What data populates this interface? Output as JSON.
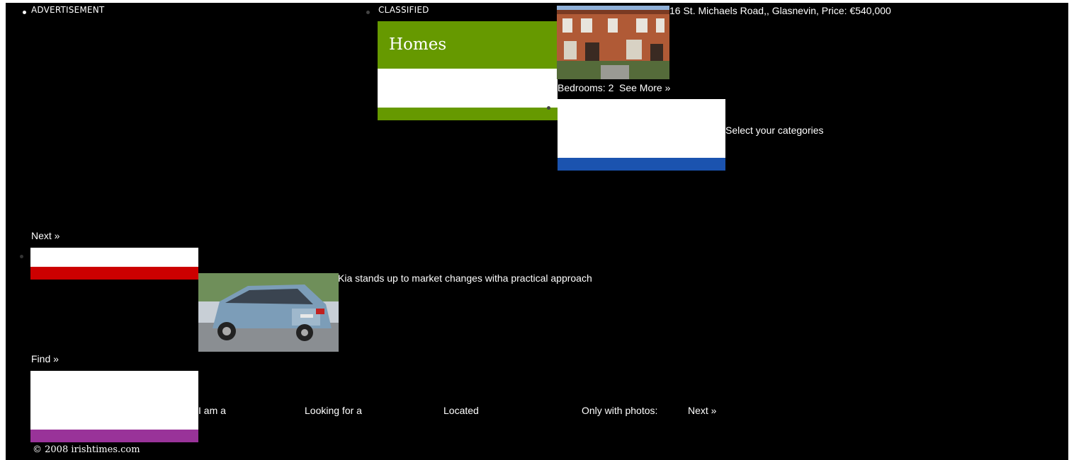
{
  "advertisement_label": "ADVERTISEMENT",
  "classified_label": "CLASSIFIED",
  "homes": {
    "title": "Homes",
    "listing_address": "16 St. Michaels Road,, Glasnevin, Price: €540,000",
    "bedrooms": "Bedrooms: 2",
    "see_more": "See More »"
  },
  "categories_label": "Select your categories",
  "next_link_1": "Next »",
  "motors": {
    "headline": "Kia stands up to market changes witha practical approach"
  },
  "find_link": "Find »",
  "search_form": {
    "i_am_a": "I am a",
    "looking_for_a": "Looking for a",
    "located": "Located",
    "only_with_photos": "Only with photos:",
    "next_link": "Next »"
  },
  "footer": "© 2008 irishtimes.com",
  "colors": {
    "homes_green": "#669900",
    "blue_bar": "#1b53af",
    "red_bar": "#cc0000",
    "purple_bar": "#993399"
  }
}
